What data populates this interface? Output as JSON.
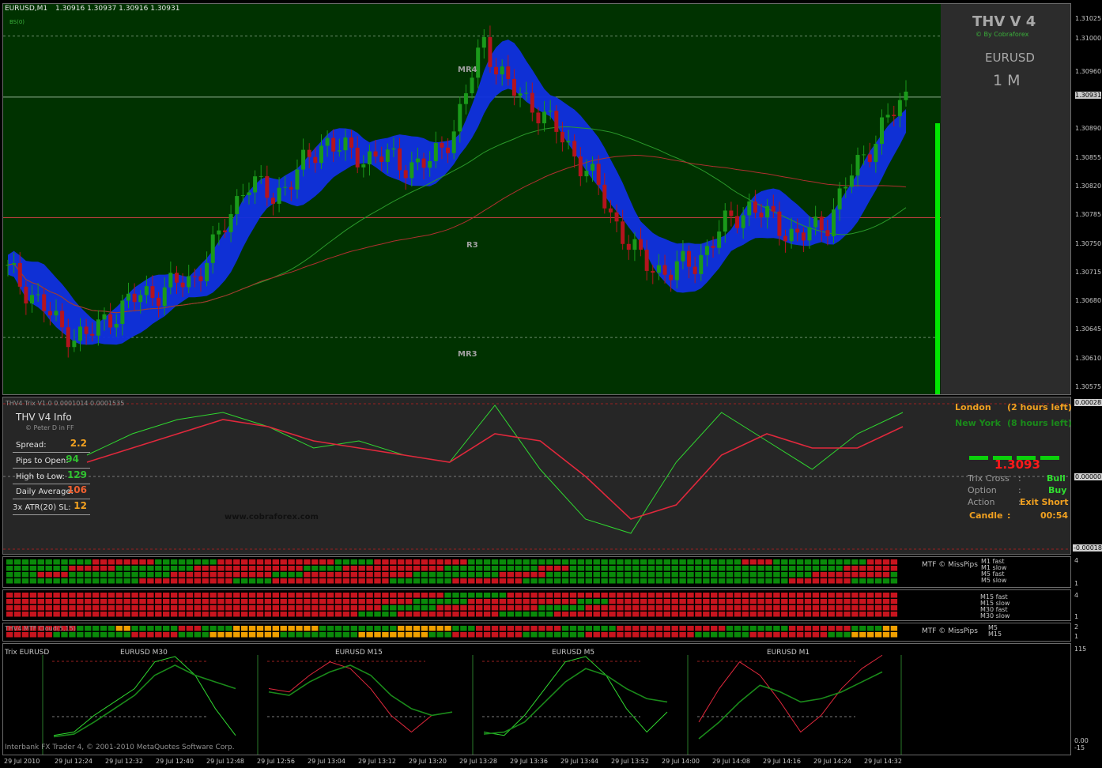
{
  "colors": {
    "bg_main": "#003200",
    "bull": "#1a9a1a",
    "bear": "#b4141e",
    "cloud": "#1030e0",
    "trix_fast": "#30d830",
    "trix_slow": "#e0283c",
    "panel": "#2c2c2c",
    "orange": "#f0a020",
    "strip_green": "#0a8a0a",
    "strip_red": "#c8141e",
    "strip_orange": "#f0a000"
  },
  "header": {
    "symbol": "EURUSD,M1",
    "ohlc": "1.30916 1.30937 1.30916 1.30931",
    "sub": "BS(0)"
  },
  "levels": {
    "mr4": "MR4",
    "r3": "R3",
    "mr3": "MR3"
  },
  "brand": {
    "title": "THV V 4",
    "by": "© By Cobraforex",
    "pair": "EURUSD",
    "tf": "1 M"
  },
  "price_axis": [
    "1.31025",
    "1.31000",
    "1.30960",
    "1.30931",
    "1.30890",
    "1.30855",
    "1.30820",
    "1.30785",
    "1.30750",
    "1.30715",
    "1.30680",
    "1.30645",
    "1.30610",
    "1.30575"
  ],
  "current_price": "1.30931",
  "trix_header": "THV4 Trix V1.0 0.0001014 0.0001535",
  "trix_axis": {
    "top": "0.00028",
    "mid": "0.00000",
    "bottom": "-0.00018"
  },
  "info": {
    "title": "THV  V4  Info",
    "credit": "© Peter D in FF",
    "rows": [
      {
        "label": "Spread:",
        "value": "2.2",
        "color": "#f0a020"
      },
      {
        "label": "Pips to Open:",
        "value": "94",
        "color": "#30c030"
      },
      {
        "label": "High to Low:",
        "value": "129",
        "color": "#30c030"
      },
      {
        "label": "Daily Average:",
        "value": "106",
        "color": "#f06030"
      },
      {
        "label": "3x ATR(20) SL:",
        "value": "12",
        "color": "#f0a020"
      }
    ],
    "website": "www.cobraforex.com"
  },
  "sessions": {
    "london": "London",
    "london_left": "(2 hours left)",
    "newyork": "New York",
    "newyork_left": "(8 hours left)"
  },
  "signal": {
    "price": "1.3093",
    "trix_cross_label": "Trix Cross",
    "trix_cross": "Bull",
    "option_label": "Option",
    "option": "Buy",
    "action_label": "Action",
    "action": "Exit Short",
    "candle_label": "Candle",
    "candle": "00:54",
    "sep": ":"
  },
  "strips": [
    {
      "label": "MTF © MissPips",
      "lines": [
        "M1 fast",
        "M1 slow",
        "M5 fast",
        "M5 slow"
      ],
      "axis": [
        "4",
        "1"
      ]
    },
    {
      "label": "",
      "lines": [
        "M15 fast",
        "M15 slow",
        "M30 fast",
        "M30 slow"
      ],
      "axis": [
        "4",
        "1"
      ]
    },
    {
      "label": "MTF © MissPips",
      "lines": [
        "M5",
        "M15"
      ],
      "axis": [
        "2",
        "1"
      ],
      "title": "THV4 MTF Cloud(5,15)"
    }
  ],
  "mtf_trix": {
    "title": "Trix EURUSD",
    "axis_top": "115",
    "axis_zero": "0.00",
    "axis_bottom": "-15",
    "charts": [
      "EURUSD M30",
      "EURUSD M15",
      "EURUSD M5",
      "EURUSD M1"
    ]
  },
  "footer": "Interbank FX Trader 4, © 2001-2010 MetaQuotes Software Corp.",
  "time_axis": [
    "29 Jul 2010",
    "29 Jul 12:24",
    "29 Jul 12:32",
    "29 Jul 12:40",
    "29 Jul 12:48",
    "29 Jul 12:56",
    "29 Jul 13:04",
    "29 Jul 13:12",
    "29 Jul 13:20",
    "29 Jul 13:28",
    "29 Jul 13:36",
    "29 Jul 13:44",
    "29 Jul 13:52",
    "29 Jul 14:00",
    "29 Jul 14:08",
    "29 Jul 14:16",
    "29 Jul 14:24",
    "29 Jul 14:32"
  ],
  "chart_data": [
    {
      "type": "candlestick",
      "title": "EURUSD,M1",
      "ylim": [
        1.30575,
        1.3104
      ],
      "x": [
        "12:20",
        "12:24",
        "12:28",
        "12:32",
        "12:36",
        "12:40",
        "12:44",
        "12:48",
        "12:52",
        "12:56",
        "13:00",
        "13:04",
        "13:08",
        "13:12",
        "13:16",
        "13:20",
        "13:24",
        "13:28",
        "13:32",
        "13:36",
        "13:40",
        "13:44",
        "13:48",
        "13:52",
        "13:56",
        "14:00",
        "14:04",
        "14:08",
        "14:12",
        "14:16",
        "14:20",
        "14:24",
        "14:28",
        "14:32",
        "14:34"
      ],
      "close": [
        1.3072,
        1.3069,
        1.3065,
        1.3064,
        1.3067,
        1.3069,
        1.307,
        1.3071,
        1.3076,
        1.3083,
        1.3081,
        1.3084,
        1.3088,
        1.3086,
        1.3086,
        1.3085,
        1.3085,
        1.309,
        1.31,
        1.3094,
        1.3092,
        1.3088,
        1.3084,
        1.3078,
        1.3073,
        1.3072,
        1.3073,
        1.3077,
        1.308,
        1.3078,
        1.3076,
        1.3078,
        1.3084,
        1.3089,
        1.30931
      ],
      "levels": [
        {
          "name": "MR4",
          "value": 1.31005
        },
        {
          "name": "R3",
          "value": 1.30785
        },
        {
          "name": "MR3",
          "value": 1.3064
        }
      ]
    },
    {
      "type": "line",
      "title": "THV4 Trix V1.0",
      "series": [
        {
          "name": "fast",
          "values": [
            0.3,
            0.6,
            0.8,
            0.9,
            0.7,
            0.4,
            0.5,
            0.3,
            0.2,
            1.0,
            0.1,
            -0.6,
            -0.8,
            0.2,
            0.9,
            0.5,
            0.1,
            0.6,
            0.9
          ]
        },
        {
          "name": "slow",
          "values": [
            0.2,
            0.4,
            0.6,
            0.8,
            0.7,
            0.5,
            0.4,
            0.3,
            0.2,
            0.6,
            0.5,
            0.0,
            -0.6,
            -0.4,
            0.3,
            0.6,
            0.4,
            0.4,
            0.7
          ]
        }
      ]
    },
    {
      "type": "line",
      "title": "EURUSD M30",
      "series": [
        {
          "name": "fast",
          "values": [
            -10,
            -5,
            20,
            40,
            60,
            100,
            108,
            80,
            30,
            -10
          ]
        },
        {
          "name": "slow",
          "values": [
            -12,
            -8,
            10,
            30,
            50,
            80,
            95,
            80,
            70,
            60
          ]
        }
      ]
    },
    {
      "type": "line",
      "title": "EURUSD M15",
      "series": [
        {
          "name": "fast",
          "values": [
            60,
            55,
            80,
            100,
            90,
            60,
            20,
            -5,
            20,
            25
          ]
        },
        {
          "name": "slow",
          "values": [
            55,
            50,
            70,
            85,
            95,
            80,
            50,
            30,
            20,
            25
          ]
        }
      ]
    },
    {
      "type": "line",
      "title": "EURUSD M5",
      "series": [
        {
          "name": "fast",
          "values": [
            -5,
            -10,
            20,
            60,
            100,
            108,
            80,
            30,
            -5,
            25
          ]
        },
        {
          "name": "slow",
          "values": [
            -8,
            -5,
            10,
            40,
            70,
            90,
            80,
            60,
            45,
            40
          ]
        }
      ]
    },
    {
      "type": "line",
      "title": "EURUSD M1",
      "series": [
        {
          "name": "fast",
          "values": [
            10,
            60,
            100,
            80,
            40,
            -5,
            20,
            60,
            90,
            110
          ]
        },
        {
          "name": "slow",
          "values": [
            -15,
            10,
            40,
            65,
            55,
            40,
            45,
            55,
            70,
            85
          ]
        }
      ]
    }
  ]
}
